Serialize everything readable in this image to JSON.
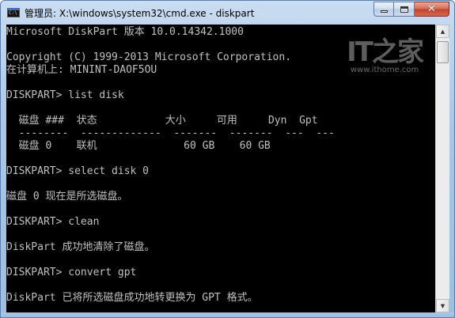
{
  "window": {
    "title": "管理员: X:\\windows\\system32\\cmd.exe - diskpart",
    "app_icon_text": "C:\\",
    "buttons": {
      "minimize": "minimize-icon",
      "maximize": "maximize-icon",
      "close": "✕"
    }
  },
  "console": {
    "lines": [
      "Microsoft DiskPart 版本 10.0.14342.1000",
      "",
      "Copyright (C) 1999-2013 Microsoft Corporation.",
      "在计算机上: MININT-DAOF5OU",
      "",
      "DISKPART> list disk",
      "",
      "  磁盘 ###  状态           大小     可用     Dyn  Gpt",
      "  --------  -------------  -------  -------  ---  ---",
      "  磁盘 0    联机              60 GB    60 GB",
      "",
      "DISKPART> select disk 0",
      "",
      "磁盘 0 现在是所选磁盘。",
      "",
      "DISKPART> clean",
      "",
      "DiskPart 成功地清除了磁盘。",
      "",
      "DISKPART> convert gpt",
      "",
      "DiskPart 已将所选磁盘成功地转更换为 GPT 格式。"
    ]
  },
  "watermark": {
    "mark": "IT之家",
    "url": "www.ithome.com"
  }
}
